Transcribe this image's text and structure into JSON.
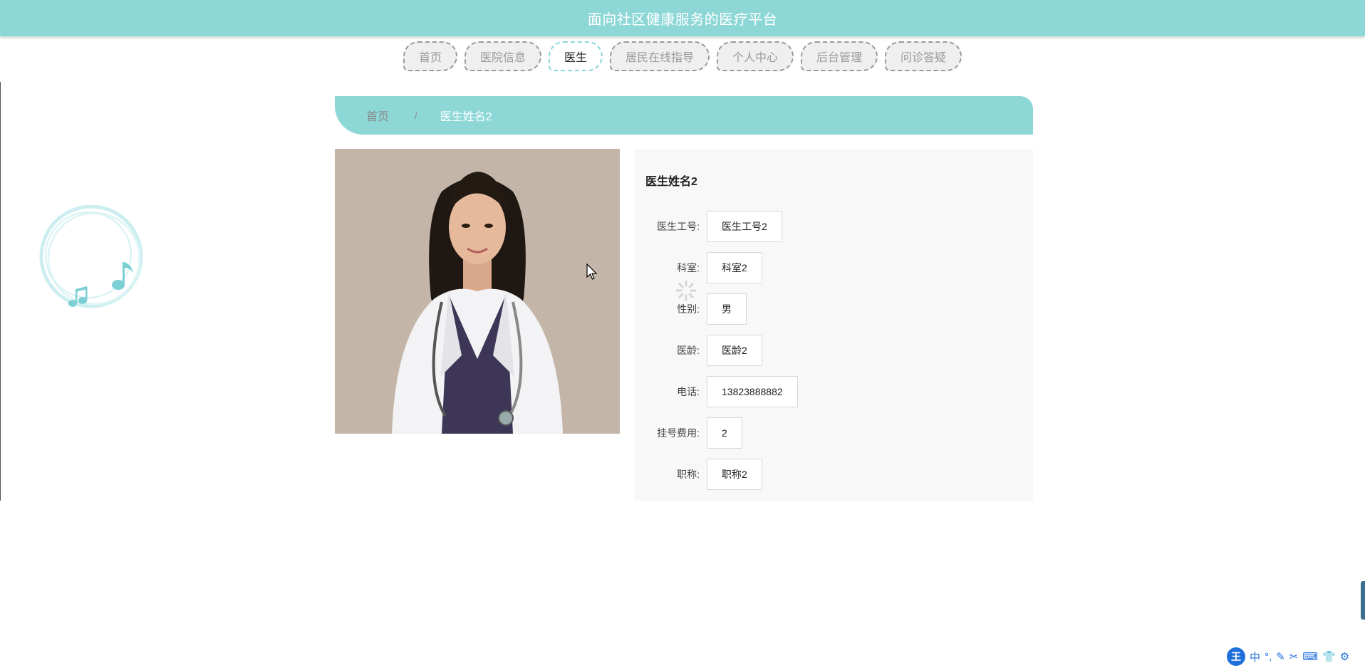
{
  "header": {
    "title": "面向社区健康服务的医疗平台"
  },
  "nav": {
    "items": [
      {
        "label": "首页"
      },
      {
        "label": "医院信息"
      },
      {
        "label": "医生"
      },
      {
        "label": "居民在线指导"
      },
      {
        "label": "个人中心"
      },
      {
        "label": "后台管理"
      },
      {
        "label": "问诊答疑"
      }
    ],
    "active_index": 2
  },
  "breadcrumb": {
    "home": "首页",
    "separator": "/",
    "current": "医生姓名2"
  },
  "doctor": {
    "name": "医生姓名2",
    "fields": [
      {
        "label": "医生工号:",
        "value": "医生工号2"
      },
      {
        "label": "科室:",
        "value": "科室2"
      },
      {
        "label": "性别:",
        "value": "男"
      },
      {
        "label": "医龄:",
        "value": "医龄2"
      },
      {
        "label": "电话:",
        "value": "13823888882"
      },
      {
        "label": "挂号费用:",
        "value": "2"
      },
      {
        "label": "职称:",
        "value": "职称2"
      }
    ]
  },
  "ime": {
    "logo": "王",
    "items": [
      "中",
      "°,",
      "✎",
      "✂",
      "⌨",
      "👕",
      "⚙"
    ]
  },
  "colors": {
    "accent": "#8dd7d7",
    "panel": "#f8f8f8"
  }
}
